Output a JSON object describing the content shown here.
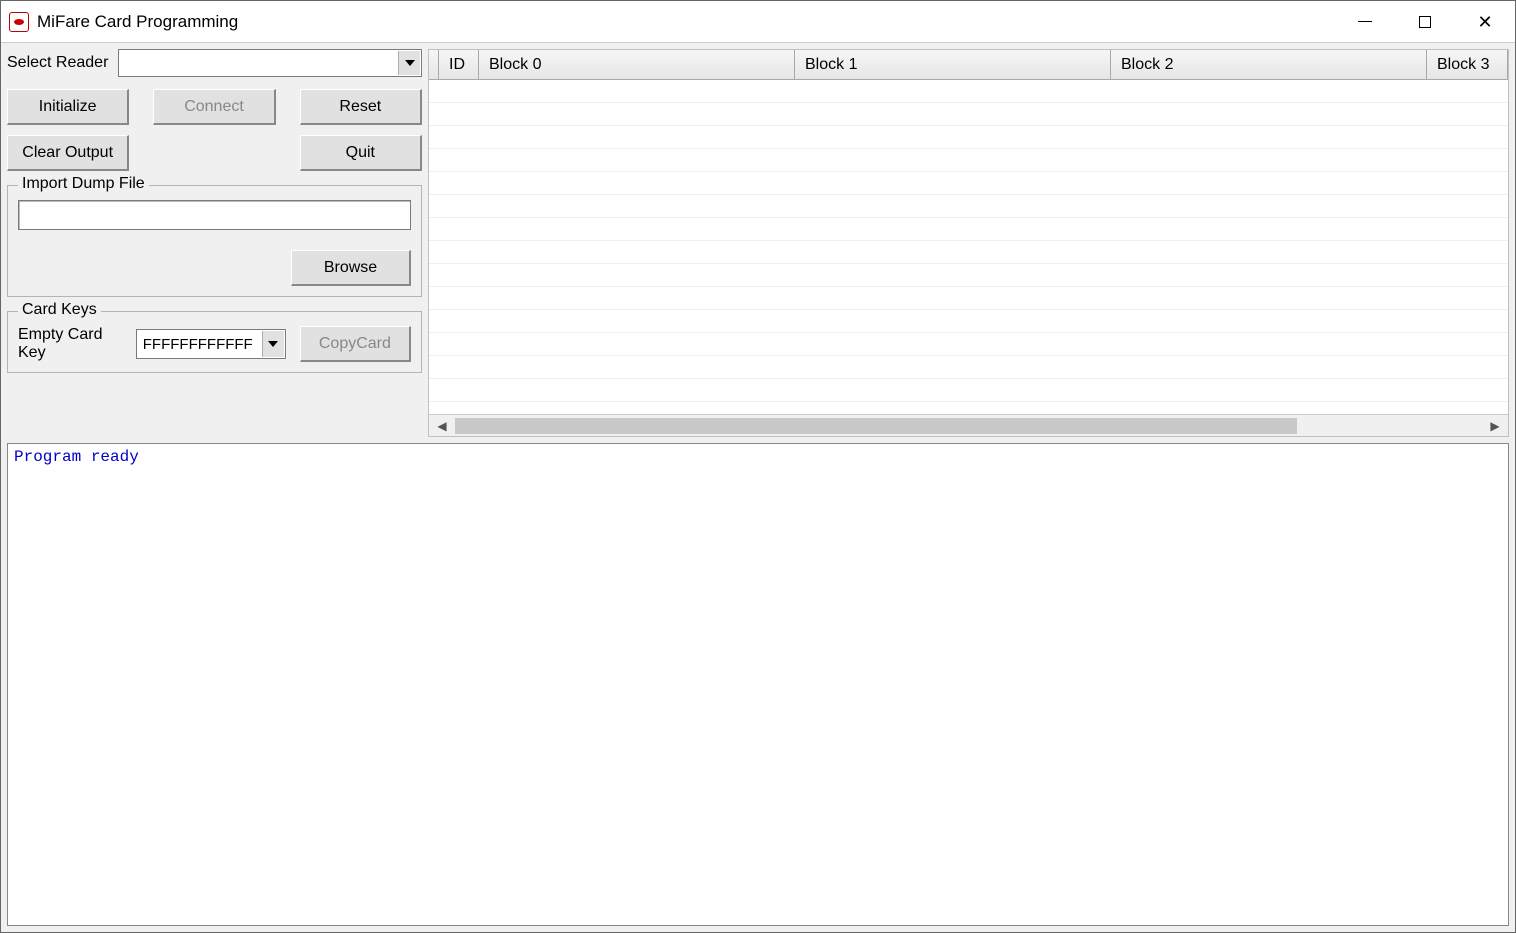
{
  "window": {
    "title": "MiFare Card Programming"
  },
  "controls": {
    "select_reader_label": "Select Reader",
    "select_reader_value": "",
    "initialize": "Initialize",
    "connect": "Connect",
    "reset": "Reset",
    "clear_output": "Clear Output",
    "quit": "Quit"
  },
  "import": {
    "legend": "Import Dump File",
    "path": "",
    "browse": "Browse"
  },
  "keys": {
    "legend": "Card Keys",
    "empty_key_label": "Empty Card Key",
    "empty_key_value": "FFFFFFFFFFFF",
    "copy_card": "CopyCard"
  },
  "grid": {
    "columns": [
      "ID",
      "Block 0",
      "Block 1",
      "Block 2",
      "Block 3"
    ]
  },
  "console": {
    "text": "Program ready"
  }
}
